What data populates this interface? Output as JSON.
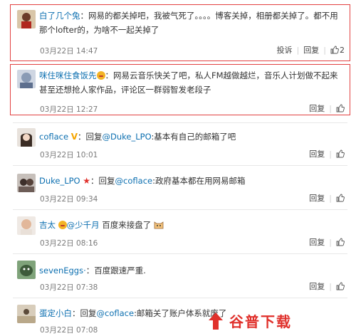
{
  "comments": [
    {
      "user": "白了几个兔",
      "text": "：网易的都关掉吧，我被气死了。。。。博客关掉，相册都关掉了。都不用那个lofter的，为啥不一起关掉了",
      "time": "03月22日 14:47",
      "actions": [
        "投诉",
        "回复"
      ],
      "likes": "2"
    },
    {
      "user": "咪住咪住食饭先",
      "text": "：网易云音乐快关了吧，私人FM越做越烂，音乐人计划做不起来甚至还想抢人家作品，评论区一群弱智发老段子",
      "time": "03月22日 12:27",
      "actions": [
        "回复"
      ],
      "likes": ""
    },
    {
      "user": "coflace",
      "text_prefix": "：回复",
      "mention": "@Duke_LPO",
      "text": ":基本有自己的邮箱了吧",
      "time": "03月22日 10:01",
      "actions": [
        "回复"
      ],
      "likes": ""
    },
    {
      "user": "Duke_LPO",
      "text_prefix": "：回复",
      "mention": "@coflace",
      "text": ":政府基本都在用网易邮箱",
      "time": "03月22日 09:34",
      "actions": [
        "回复"
      ],
      "likes": ""
    },
    {
      "user": "吉太",
      "mention": "@少千月",
      "text": " 百度来接盘了",
      "time": "03月22日 08:16",
      "actions": [
        "回复"
      ],
      "likes": ""
    },
    {
      "user": "sevenEggs·",
      "text": "：百度跟速严重.",
      "time": "03月22日 07:38",
      "actions": [
        "回复"
      ],
      "likes": ""
    },
    {
      "user": "蛋定小白",
      "text_prefix": "：回复",
      "mention": "@coflace",
      "text": ":邮箱关了账户体系就废了",
      "time": "03月22日 07:08",
      "actions": [],
      "likes": ""
    }
  ],
  "watermark": "谷普下载",
  "colors": {
    "link": "#0c6fb0",
    "highlight_border": "#e24040",
    "watermark": "#e0302b"
  }
}
